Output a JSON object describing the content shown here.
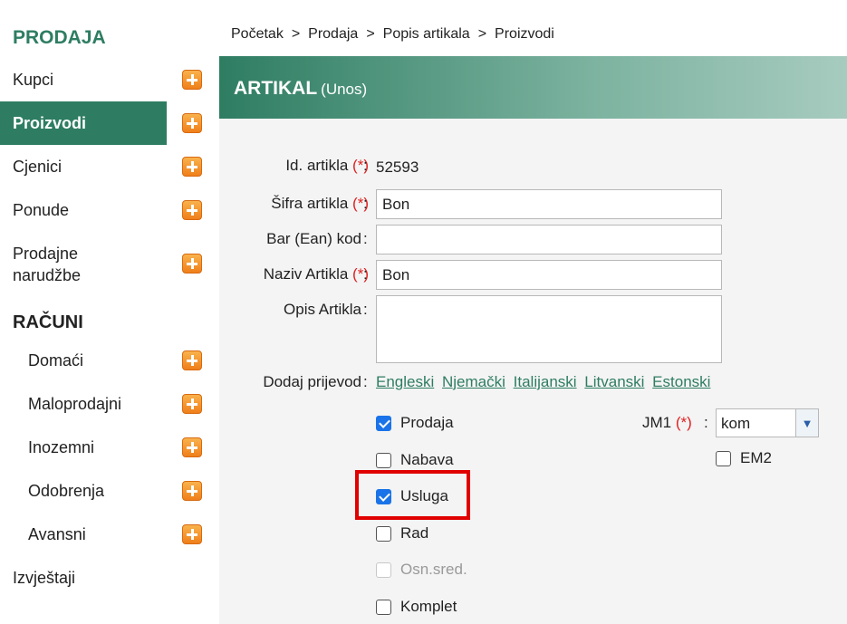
{
  "sidebar": {
    "heading_sales": "PRODAJA",
    "items": [
      {
        "label": "Kupci"
      },
      {
        "label": "Proizvodi"
      },
      {
        "label": "Cjenici"
      },
      {
        "label": "Ponude"
      },
      {
        "label": "Prodajne",
        "label2": "narudžbe"
      }
    ],
    "heading_invoices": "RAČUNI",
    "sub_items": [
      {
        "label": "Domaći"
      },
      {
        "label": "Maloprodajni"
      },
      {
        "label": "Inozemni"
      },
      {
        "label": "Odobrenja"
      },
      {
        "label": "Avansni"
      }
    ],
    "reports": "Izvještaji"
  },
  "breadcrumb": [
    "Početak",
    "Prodaja",
    "Popis artikala",
    "Proizvodi"
  ],
  "breadcrumb_sep": ">",
  "banner": {
    "title": "ARTIKAL",
    "subtitle": "(Unos)"
  },
  "form": {
    "required_mark": "(*)",
    "id_label": "Id. artikla",
    "id_value": "52593",
    "sifra_label": "Šifra artikla",
    "sifra_value": "Bon",
    "barcode_label": "Bar (Ean) kod",
    "barcode_value": "",
    "naziv_label": "Naziv Artikla",
    "naziv_value": "Bon",
    "opis_label": "Opis Artikla",
    "opis_value": "",
    "translate_label": "Dodaj prijevod",
    "translations": [
      "Engleski",
      "Njemački",
      "Italijanski",
      "Litvanski",
      "Estonski"
    ],
    "checkboxes": [
      {
        "label": "Prodaja",
        "checked": true,
        "disabled": false
      },
      {
        "label": "Nabava",
        "checked": false,
        "disabled": false
      },
      {
        "label": "Usluga",
        "checked": true,
        "disabled": false
      },
      {
        "label": "Rad",
        "checked": false,
        "disabled": false
      },
      {
        "label": "Osn.sred.",
        "checked": false,
        "disabled": true
      },
      {
        "label": "Komplet",
        "checked": false,
        "disabled": false
      }
    ],
    "jm1_label": "JM1",
    "jm1_value": "kom",
    "em2_label": "EM2",
    "em2_checked": false
  },
  "colors": {
    "brand": "#2e7d62",
    "required": "#e02020",
    "highlight": "#e00000",
    "checkbox": "#1a73e8",
    "icon_add": "#ef7f1a"
  },
  "icons": {
    "add": "plus-square-icon",
    "dropdown": "chevron-down-icon"
  }
}
